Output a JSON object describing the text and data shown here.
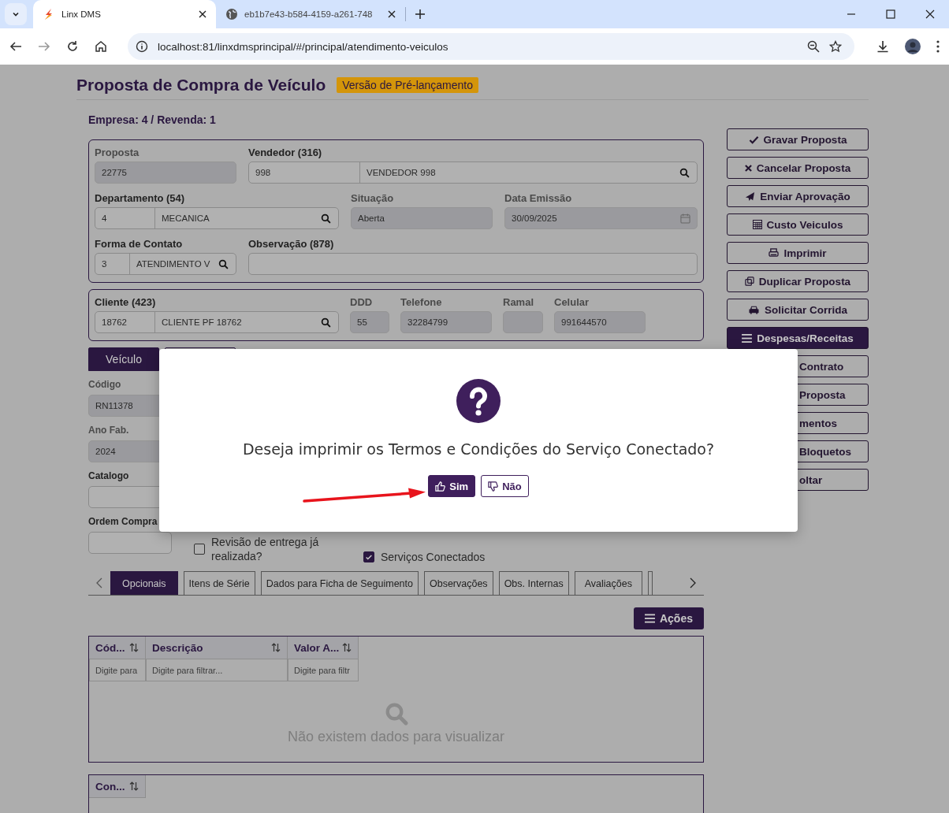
{
  "browser": {
    "tabs": [
      {
        "title": "Linx DMS",
        "selected": true
      },
      {
        "title": "eb1b7e43-b584-4159-a261-748",
        "selected": false
      }
    ],
    "url": "localhost:81/linxdmsprincipal/#/principal/atendimento-veiculos"
  },
  "page": {
    "title": "Proposta de Compra de Veículo",
    "badge": "Versão de Pré-lançamento",
    "company": "Empresa: 4 / Revenda: 1"
  },
  "proposal_fields": [
    {
      "kind": "text",
      "label": "Proposta",
      "value": "22775",
      "disabled": true
    },
    {
      "kind": "lookup",
      "label": "Vendedor (316)",
      "code": "998",
      "value": "VENDEDOR 998",
      "disabled": false
    },
    {
      "kind": "lookup",
      "label": "Departamento (54)",
      "code": "4",
      "value": "MECANICA",
      "disabled": false
    },
    {
      "kind": "text",
      "label": "Situação",
      "value": "Aberta",
      "disabled": true
    },
    {
      "kind": "date",
      "label": "Data Emissão",
      "value": "30/09/2025",
      "disabled": true
    },
    {
      "kind": "lookup",
      "label": "Forma de Contato",
      "code": "3",
      "value": "ATENDIMENTO V",
      "disabled": false
    },
    {
      "kind": "text",
      "label": "Observação (878)",
      "disabled": false
    }
  ],
  "client_fields": [
    {
      "kind": "lookup",
      "label": "Cliente (423)",
      "code": "18762",
      "value": "CLIENTE PF 18762",
      "disabled": false
    },
    {
      "kind": "text",
      "label": "DDD",
      "value": "55",
      "disabled": true
    },
    {
      "kind": "text",
      "label": "Telefone",
      "value": "32284799",
      "disabled": true
    },
    {
      "kind": "text",
      "label": "Ramal",
      "disabled": true
    },
    {
      "kind": "text",
      "label": "Celular",
      "value": "991644570",
      "disabled": true
    }
  ],
  "vehicle_tabs": [
    {
      "label": "Veículo",
      "selected": true
    },
    {
      "selected": false
    }
  ],
  "vehicle_fields": [
    {
      "label": "Código",
      "value": "RN11378",
      "disabled": true
    },
    {
      "label": "Ano Fab.",
      "value": "2024",
      "disabled": true
    },
    {
      "label": "Catalogo",
      "disabled": false
    },
    {
      "label": "Ordem Compra",
      "disabled": false
    }
  ],
  "checkboxes": [
    {
      "label": "Revisão de entrega já realizada?",
      "checked": false
    },
    {
      "label": "Serviços Conectados",
      "checked": true
    }
  ],
  "detail_tabs": [
    {
      "label": "Opcionais",
      "selected": true
    },
    {
      "label": "Itens de Série",
      "selected": false
    },
    {
      "label": "Dados para Ficha de Seguimento",
      "selected": false
    },
    {
      "label": "Observações",
      "selected": false
    },
    {
      "label": "Obs. Internas",
      "selected": false
    },
    {
      "label": "Avaliações",
      "selected": false
    },
    {
      "selected": false
    }
  ],
  "actions_button": "Ações",
  "grids": [
    {
      "columns": [
        {
          "label": "Cód...",
          "filter_placeholder": "Digite para"
        },
        {
          "label": "Descrição",
          "filter_placeholder": "Digite para filtrar..."
        },
        {
          "label": "Valor A...",
          "filter_placeholder": "Digite para filtr"
        }
      ],
      "empty_message": "Não existem dados para visualizar"
    },
    {
      "columns": [
        {
          "label": "Con..."
        }
      ]
    }
  ],
  "side_buttons": [
    {
      "label": "Gravar Proposta",
      "kind": "outline"
    },
    {
      "label": "Cancelar Proposta",
      "kind": "outline"
    },
    {
      "label": "Enviar Aprovação",
      "kind": "outline"
    },
    {
      "label": "Custo Veiculos",
      "kind": "outline"
    },
    {
      "label": "Imprimir",
      "kind": "outline"
    },
    {
      "label": "Duplicar Proposta",
      "kind": "outline"
    },
    {
      "label": "Solicitar Corrida",
      "kind": "outline"
    },
    {
      "label": "Despesas/Receitas",
      "kind": "filled"
    },
    {
      "label": "Contrato",
      "kind": "covered"
    },
    {
      "label": "Proposta",
      "kind": "covered"
    },
    {
      "label": "mentos",
      "kind": "covered"
    },
    {
      "label": "Bloquetos",
      "kind": "covered"
    },
    {
      "label": "oltar",
      "kind": "covered"
    }
  ],
  "dialog": {
    "message": "Deseja imprimir os Termos e Condições do Serviço Conectado?",
    "buttons": [
      {
        "label": "Sim",
        "kind": "primary"
      },
      {
        "label": "Não",
        "kind": "secondary"
      }
    ]
  }
}
